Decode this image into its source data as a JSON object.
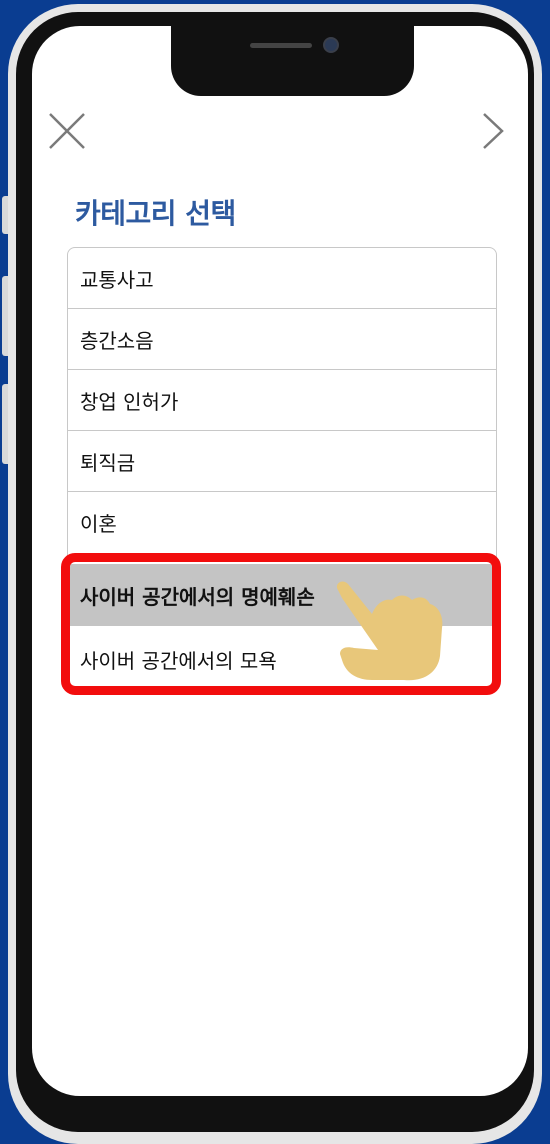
{
  "header": {
    "close_icon": "close-icon",
    "next_icon": "chevron-right-icon"
  },
  "title": "카테고리 선택",
  "categories": [
    "교통사고",
    "층간소음",
    "창업 인허가",
    "퇴직금",
    "이혼"
  ],
  "highlighted_items": {
    "selected": "사이버 공간에서의 명예훼손",
    "other": "사이버 공간에서의 모욕"
  },
  "colors": {
    "background": "#0a3d91",
    "title": "#2d5aa0",
    "highlight_border": "#f20d0d",
    "selected_bg": "#c4c4c4",
    "hand": "#e8c77a"
  }
}
